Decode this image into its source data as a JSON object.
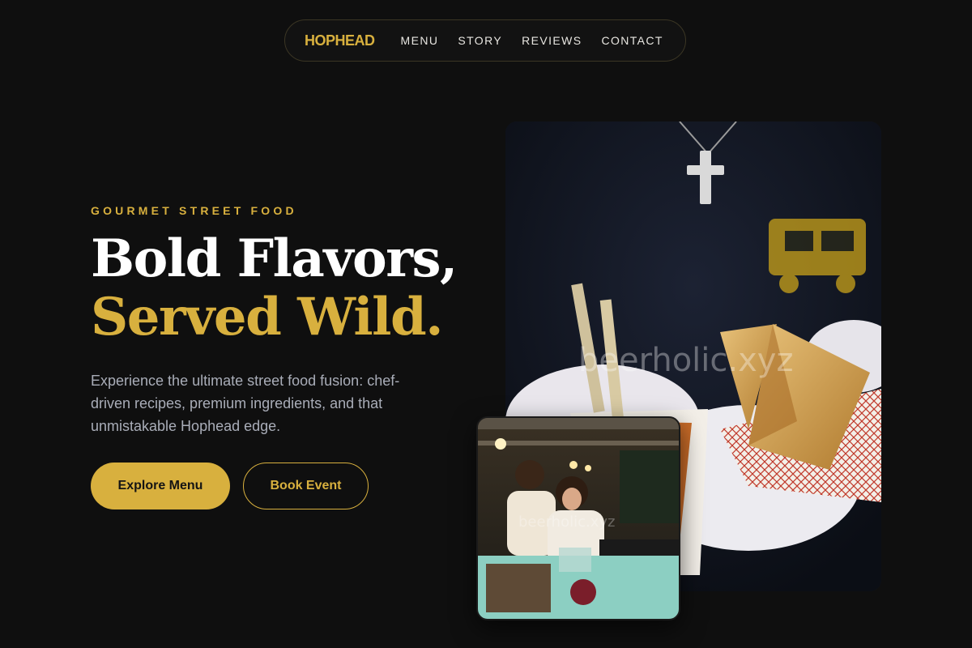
{
  "nav": {
    "brand": "HOPHEAD",
    "links": [
      "MENU",
      "STORY",
      "REVIEWS",
      "CONTACT"
    ]
  },
  "hero": {
    "eyebrow": "GOURMET STREET FOOD",
    "headline_line1": "Bold Flavors,",
    "headline_line2": "Served Wild.",
    "description": "Experience the ultimate street food fusion: chef-driven recipes, premium ingredients, and that unmistakable Hophead edge.",
    "primary_cta": "Explore Menu",
    "secondary_cta": "Book Event"
  },
  "images": {
    "main_watermark": "beerholic.xyz",
    "small_watermark": "beerholic.xyz"
  },
  "colors": {
    "background": "#0f0f0f",
    "accent": "#d8b03e",
    "text": "#ffffff",
    "muted": "#a9adb8"
  }
}
